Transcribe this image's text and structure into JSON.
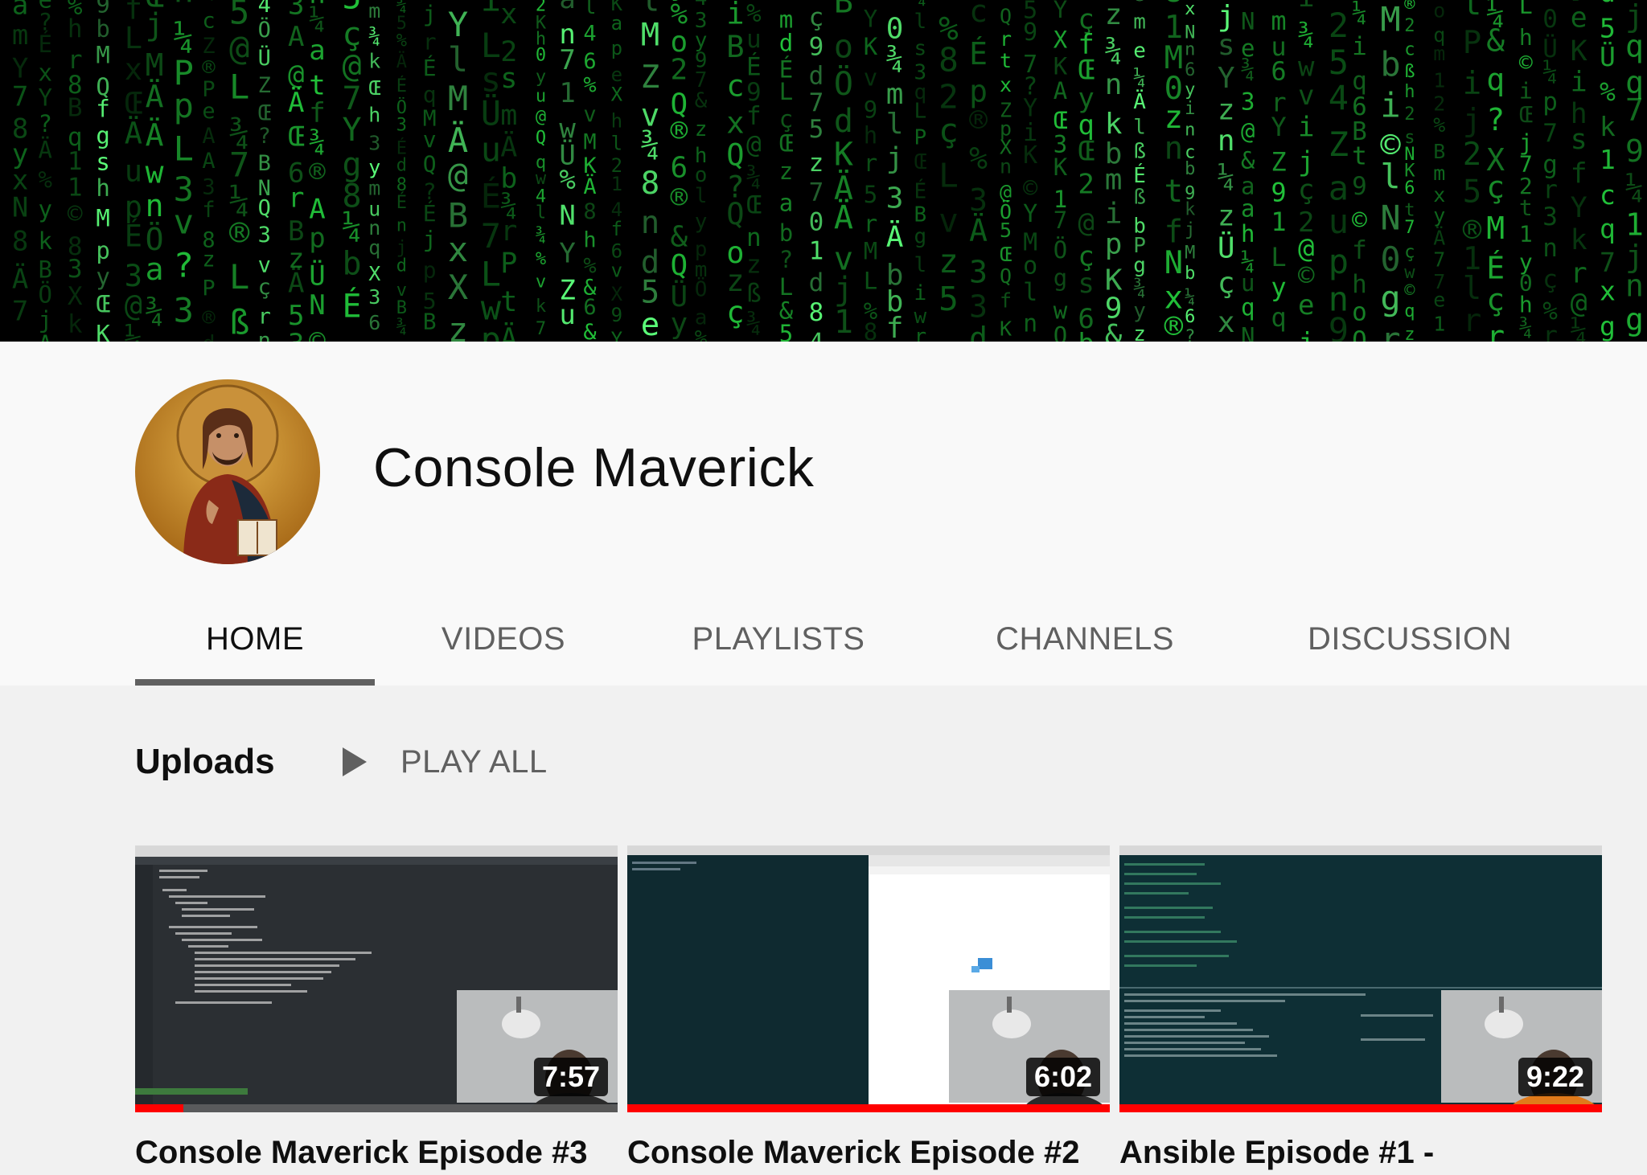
{
  "channel": {
    "name": "Console Maverick"
  },
  "tabs": [
    {
      "label": "HOME",
      "active": true
    },
    {
      "label": "VIDEOS",
      "active": false
    },
    {
      "label": "PLAYLISTS",
      "active": false
    },
    {
      "label": "CHANNELS",
      "active": false
    },
    {
      "label": "DISCUSSION",
      "active": false
    }
  ],
  "uploads": {
    "title": "Uploads",
    "play_all_label": "PLAY ALL",
    "videos": [
      {
        "title": "Console Maverick Episode #3",
        "duration": "7:57",
        "watched_fraction": 0.1
      },
      {
        "title": "Console Maverick Episode #2",
        "duration": "6:02",
        "watched_fraction": 1.0
      },
      {
        "title": "Ansible Episode #1 -",
        "duration": "9:22",
        "watched_fraction": 1.0
      }
    ]
  },
  "colors": {
    "accent_progress": "#ff0000",
    "banner_green": "#22c33a",
    "tab_underline": "#606060"
  }
}
